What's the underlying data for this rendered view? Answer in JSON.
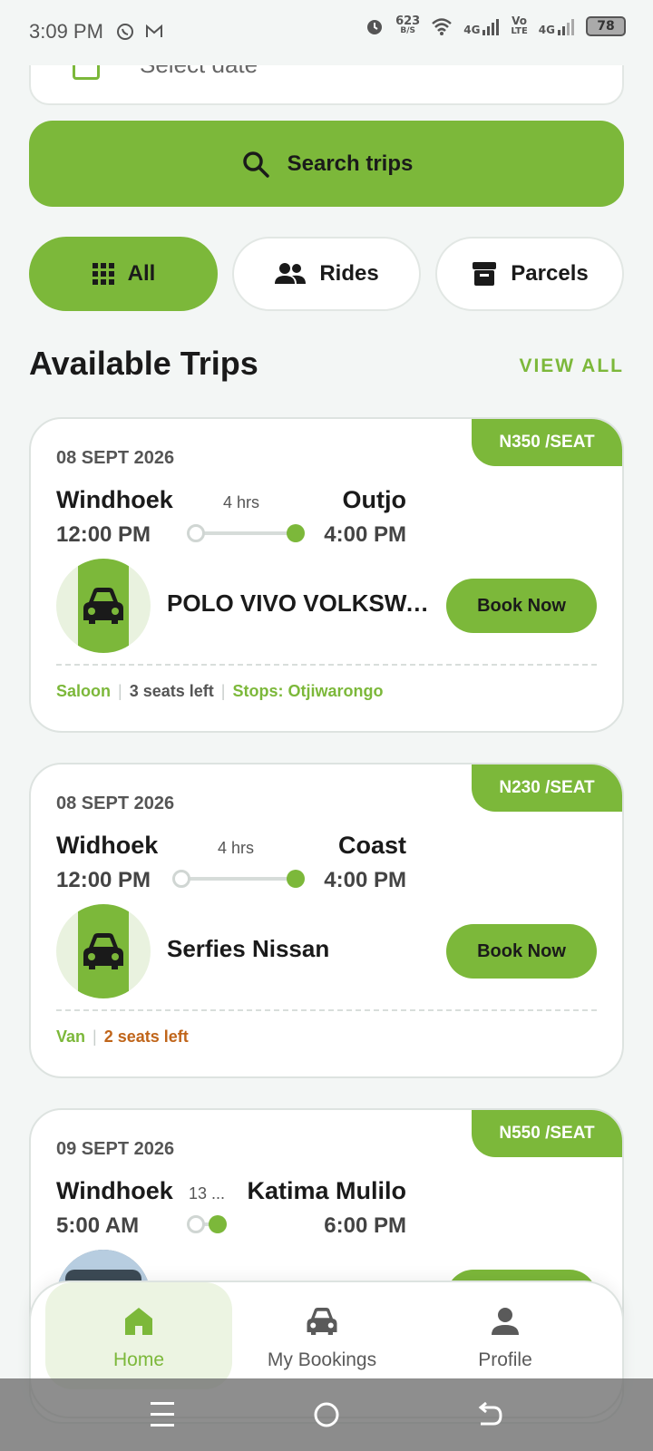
{
  "status_bar": {
    "time": "3:09 PM",
    "net_speed": "623",
    "net_unit": "B/S",
    "signal_1": "4G",
    "volte_top": "Vo",
    "volte_bottom": "LTE",
    "signal_2": "4G",
    "battery": "78"
  },
  "date_field": {
    "placeholder": "Select date"
  },
  "search": {
    "label": "Search trips"
  },
  "filters": [
    {
      "label": "All",
      "icon": "grid-icon",
      "active": true
    },
    {
      "label": "Rides",
      "icon": "people-icon",
      "active": false
    },
    {
      "label": "Parcels",
      "icon": "archive-icon",
      "active": false
    }
  ],
  "section": {
    "title": "Available Trips",
    "view_all": "VIEW ALL"
  },
  "trips": [
    {
      "price": "N350 /SEAT",
      "date": "08 SEPT 2026",
      "from": "Windhoek",
      "to": "Outjo",
      "depart": "12:00 PM",
      "arrive": "4:00 PM",
      "duration": "4 hrs",
      "vehicle": "POLO VIVO VOLKSWA...",
      "book": "Book Now",
      "type": "Saloon",
      "seats": "3 seats left",
      "stops": "Stops: Otjiwarongo"
    },
    {
      "price": "N230 /SEAT",
      "date": "08 SEPT 2026",
      "from": "Widhoek",
      "to": "Coast",
      "depart": "12:00 PM",
      "arrive": "4:00 PM",
      "duration": "4 hrs",
      "vehicle": "Serfies Nissan",
      "book": "Book Now",
      "type": "Van",
      "seats": "2 seats left"
    },
    {
      "price": "N550 /SEAT",
      "date": "09 SEPT 2026",
      "from": "Windhoek",
      "to": "Katima Mulilo",
      "depart": "5:00 AM",
      "arrive": "6:00 PM",
      "duration": "13 ..."
    }
  ],
  "nav": [
    {
      "label": "Home",
      "icon": "home-icon",
      "active": true
    },
    {
      "label": "My Bookings",
      "icon": "car-icon",
      "active": false
    },
    {
      "label": "Profile",
      "icon": "person-icon",
      "active": false
    }
  ],
  "colors": {
    "accent": "#7cb83a",
    "background": "#f3f6f5",
    "warning": "#c0651a"
  }
}
